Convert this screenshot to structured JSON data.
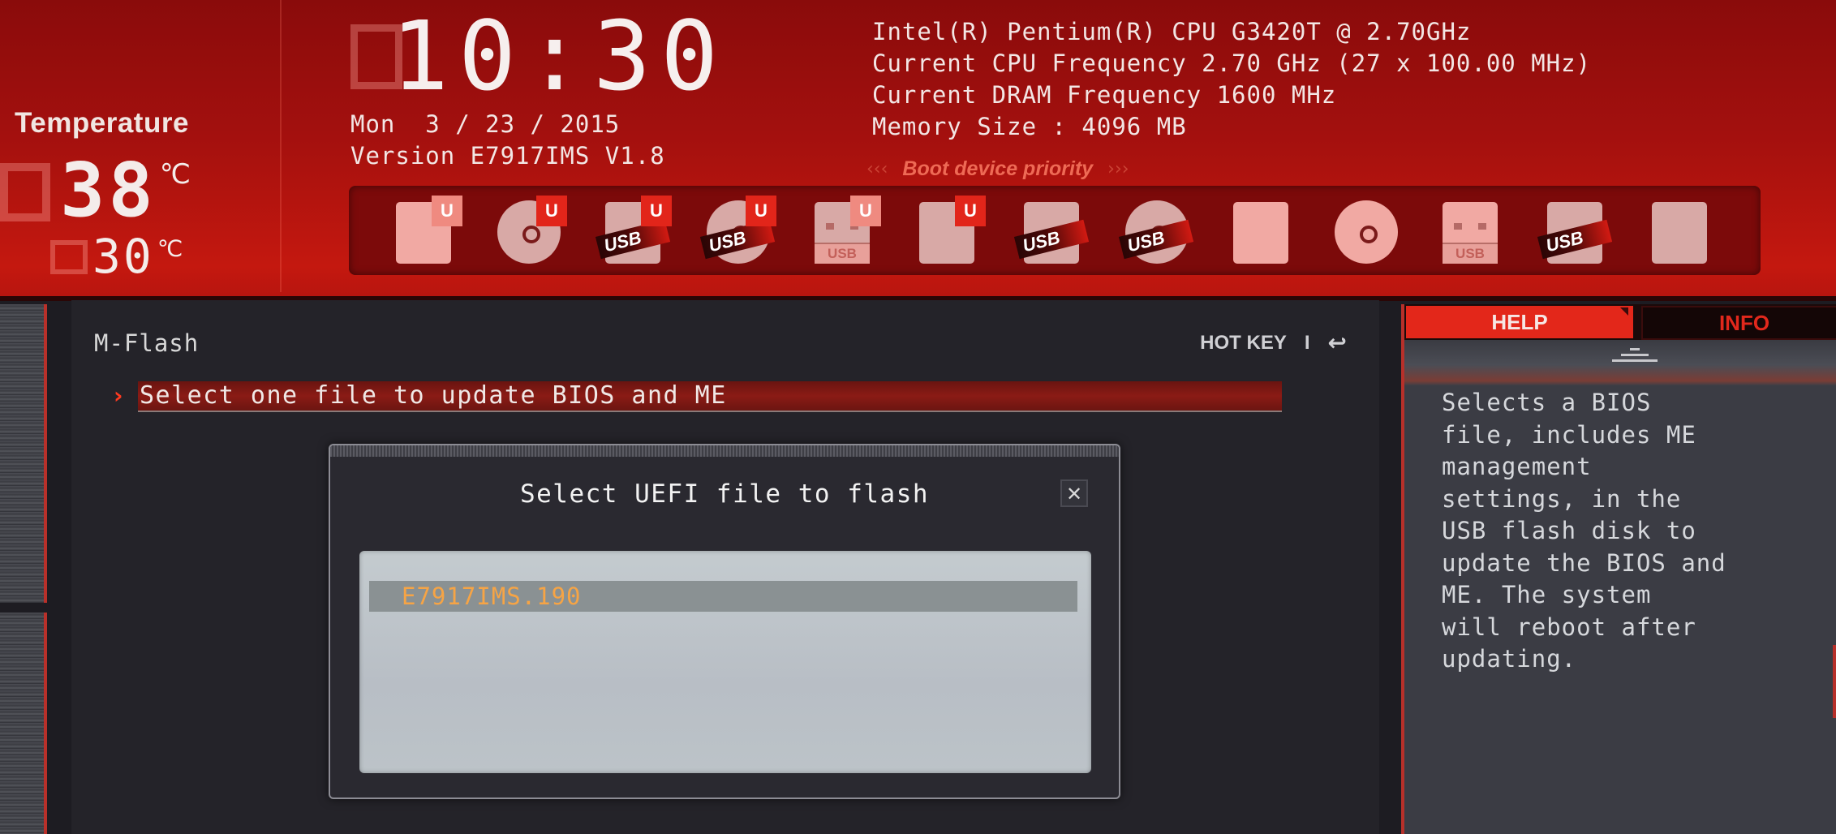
{
  "temperature": {
    "label": "Temperature",
    "cpu_value": "38",
    "board_value": "30",
    "unit": "℃"
  },
  "clock": {
    "time": "10:30",
    "date": "Mon  3 / 23 / 2015",
    "version": "Version E7917IMS V1.8"
  },
  "system_info": [
    "Intel(R) Pentium(R) CPU G3420T @ 2.70GHz",
    "Current CPU Frequency 2.70 GHz (27 x 100.00 MHz)",
    "Current DRAM Frequency 1600 MHz",
    "Memory Size : 4096 MB"
  ],
  "boot_priority": {
    "label": "Boot device priority",
    "left_arrows": "‹‹‹",
    "right_arrows": "›››",
    "devices": [
      {
        "name": "uefi-hard-disk",
        "icon": "hdd-icon",
        "uefi_badge": "U",
        "usb_tag": "",
        "usb_label": ""
      },
      {
        "name": "uefi-optical-disk",
        "icon": "disc-icon",
        "uefi_badge": "U",
        "usb_tag": "",
        "usb_label": ""
      },
      {
        "name": "uefi-usb-hard-disk",
        "icon": "hdd-icon",
        "uefi_badge": "U",
        "usb_tag": "USB",
        "usb_label": ""
      },
      {
        "name": "uefi-usb-optical-disk",
        "icon": "disc-icon",
        "uefi_badge": "U",
        "usb_tag": "USB",
        "usb_label": ""
      },
      {
        "name": "uefi-usb-key",
        "icon": "usb-key-icon",
        "uefi_badge": "U",
        "usb_tag": "",
        "usb_label": "USB"
      },
      {
        "name": "uefi-network",
        "icon": "network-icon",
        "uefi_badge": "U",
        "usb_tag": "",
        "usb_label": ""
      },
      {
        "name": "usb-hard-disk",
        "icon": "hdd-icon",
        "uefi_badge": "",
        "usb_tag": "USB",
        "usb_label": ""
      },
      {
        "name": "usb-optical-disk",
        "icon": "disc-icon",
        "uefi_badge": "",
        "usb_tag": "USB",
        "usb_label": ""
      },
      {
        "name": "hard-disk",
        "icon": "hdd-icon",
        "uefi_badge": "",
        "usb_tag": "",
        "usb_label": ""
      },
      {
        "name": "optical-disk",
        "icon": "disc-icon",
        "uefi_badge": "",
        "usb_tag": "",
        "usb_label": ""
      },
      {
        "name": "usb-key",
        "icon": "usb-key-icon",
        "uefi_badge": "",
        "usb_tag": "",
        "usb_label": "USB"
      },
      {
        "name": "usb-floppy",
        "icon": "floppy-icon",
        "uefi_badge": "",
        "usb_tag": "USB",
        "usb_label": ""
      },
      {
        "name": "network",
        "icon": "network-icon",
        "uefi_badge": "",
        "usb_tag": "",
        "usb_label": ""
      }
    ]
  },
  "main": {
    "title": "M-Flash",
    "hotkey_label": "HOT KEY",
    "hotkey_separator": "I",
    "back_icon": "↩",
    "menu_item_label": "Select one file to update BIOS and ME",
    "menu_item_chevron": "›"
  },
  "dialog": {
    "title": "Select UEFI file to flash",
    "close_icon": "✕",
    "files": [
      "E7917IMS.190"
    ],
    "selected_file": "E7917IMS.190"
  },
  "help_panel": {
    "tabs": [
      "HELP",
      "INFO"
    ],
    "active_tab": "HELP",
    "text": "Selects a BIOS\nfile, includes ME\nmanagement\nsettings, in the\nUSB flash disk to\nupdate the BIOS and\nME.  The system\nwill reboot after\nupdating."
  },
  "colors": {
    "header_red": "#b8150f",
    "accent_red": "#e3271a",
    "selected_file_text": "#f6a445",
    "panel_dark": "#242329"
  }
}
